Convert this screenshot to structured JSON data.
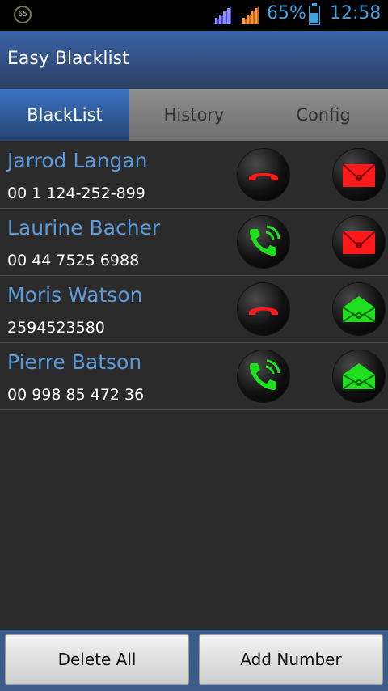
{
  "status_bar": {
    "badge": "65",
    "battery_pct": "65%",
    "battery_level": 0.65,
    "time": "12:58",
    "accent": "#3fa3e0"
  },
  "app": {
    "title": "Easy Blacklist"
  },
  "tabs": [
    {
      "label": "BlackList",
      "active": true
    },
    {
      "label": "History",
      "active": false
    },
    {
      "label": "Config",
      "active": false
    }
  ],
  "contacts": [
    {
      "name": "Jarrod Langan",
      "number": "00 1 124-252-899",
      "call_blocked": true,
      "sms_blocked": true
    },
    {
      "name": "Laurine Bacher",
      "number": "00 44 7525 6988",
      "call_blocked": false,
      "sms_blocked": true
    },
    {
      "name": "Moris Watson",
      "number": "2594523580",
      "call_blocked": true,
      "sms_blocked": false
    },
    {
      "name": "Pierre Batson",
      "number": "00 998 85 472 36",
      "call_blocked": false,
      "sms_blocked": false
    }
  ],
  "icons": {
    "call_blocked": "red-phone-hangup-icon",
    "call_allowed": "green-phone-ringing-icon",
    "sms_blocked": "red-envelope-closed-icon",
    "sms_allowed": "green-envelope-open-icon"
  },
  "colors": {
    "blocked": "#ff1a1a",
    "allowed": "#1fe01f",
    "name": "#5b9bdc"
  },
  "buttons": {
    "delete_all": "Delete All",
    "add_number": "Add Number"
  }
}
